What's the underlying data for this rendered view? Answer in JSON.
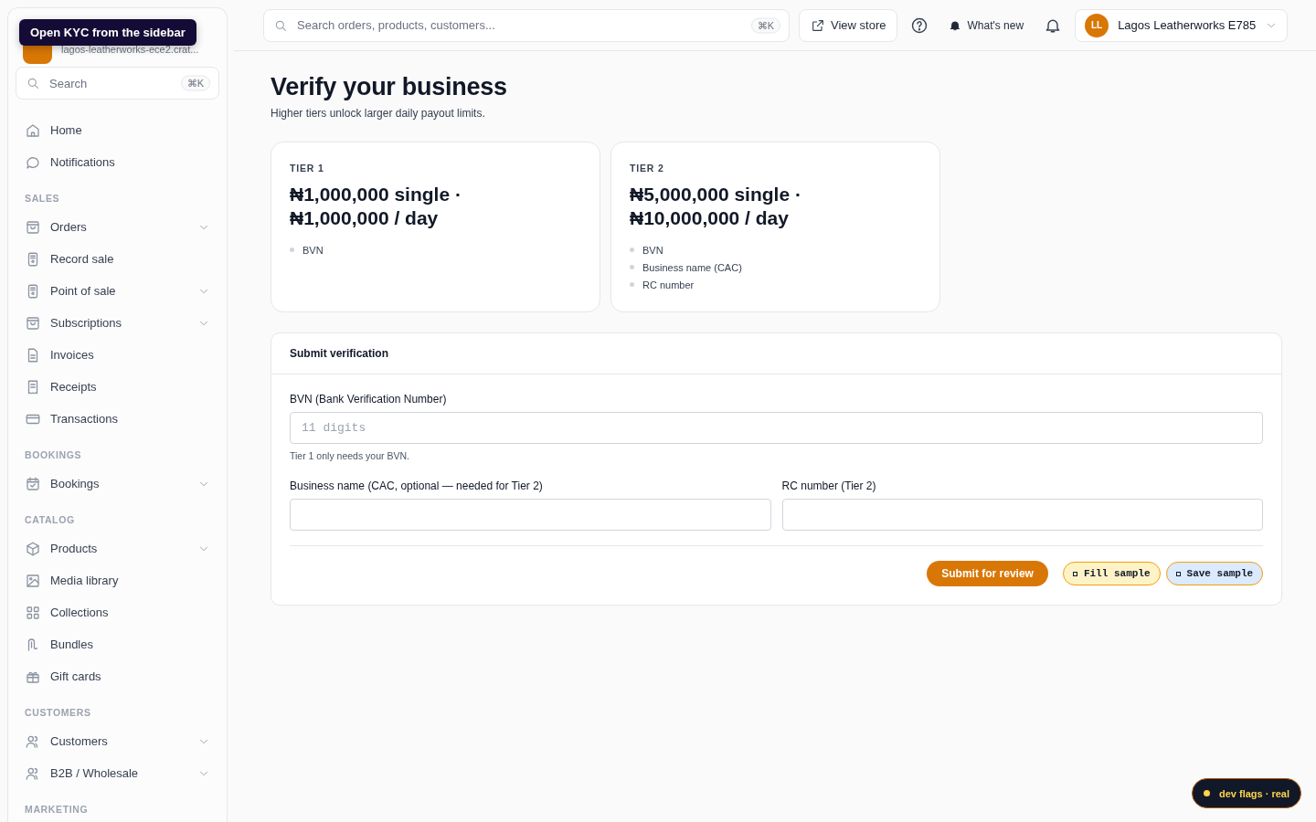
{
  "tooltip": "Open KYC from the sidebar",
  "store": {
    "subdomain": "lagos-leatherworks-ece2.crat..."
  },
  "sidebar_search": {
    "placeholder": "Search",
    "shortcut": "⌘K"
  },
  "nav": [
    {
      "items": [
        {
          "label": "Home",
          "kind": "home",
          "expandable": false
        },
        {
          "label": "Notifications",
          "kind": "chat",
          "expandable": false
        }
      ]
    },
    {
      "heading": "SALES",
      "items": [
        {
          "label": "Orders",
          "kind": "bag",
          "expandable": true
        },
        {
          "label": "Record sale",
          "kind": "pos",
          "expandable": false
        },
        {
          "label": "Point of sale",
          "kind": "pos",
          "expandable": true
        },
        {
          "label": "Subscriptions",
          "kind": "bag",
          "expandable": true
        },
        {
          "label": "Invoices",
          "kind": "doc",
          "expandable": false
        },
        {
          "label": "Receipts",
          "kind": "receipt",
          "expandable": false
        },
        {
          "label": "Transactions",
          "kind": "card",
          "expandable": false
        }
      ]
    },
    {
      "heading": "BOOKINGS",
      "items": [
        {
          "label": "Bookings",
          "kind": "calendar",
          "expandable": true
        }
      ]
    },
    {
      "heading": "CATALOG",
      "items": [
        {
          "label": "Products",
          "kind": "box",
          "expandable": true
        },
        {
          "label": "Media library",
          "kind": "image",
          "expandable": false
        },
        {
          "label": "Collections",
          "kind": "grid",
          "expandable": false
        },
        {
          "label": "Bundles",
          "kind": "bundle",
          "expandable": false
        },
        {
          "label": "Gift cards",
          "kind": "gift",
          "expandable": false
        }
      ]
    },
    {
      "heading": "CUSTOMERS",
      "items": [
        {
          "label": "Customers",
          "kind": "users",
          "expandable": true
        },
        {
          "label": "B2B / Wholesale",
          "kind": "users",
          "expandable": true
        }
      ]
    },
    {
      "heading": "MARKETING"
    }
  ],
  "topbar": {
    "search_placeholder": "Search orders, products, customers...",
    "shortcut": "⌘K",
    "view_store": "View store",
    "whats_new": "What's new",
    "account": {
      "initials": "LL",
      "name": "Lagos Leatherworks E785"
    }
  },
  "page": {
    "title": "Verify your business",
    "subtitle": "Higher tiers unlock larger daily payout limits."
  },
  "tiers": [
    {
      "label": "TIER 1",
      "limits": "₦1,000,000 single · ₦1,000,000 / day",
      "requirements": [
        "BVN"
      ]
    },
    {
      "label": "TIER 2",
      "limits": "₦5,000,000 single · ₦10,000,000 / day",
      "requirements": [
        "BVN",
        "Business name (CAC)",
        "RC number"
      ]
    }
  ],
  "form": {
    "title": "Submit verification",
    "bvn": {
      "label": "BVN (Bank Verification Number)",
      "placeholder": "11 digits",
      "hint": "Tier 1 only needs your BVN."
    },
    "business_name": {
      "label": "Business name (CAC, optional — needed for Tier 2)"
    },
    "rc_number": {
      "label": "RC number (Tier 2)"
    },
    "submit": "Submit for review",
    "dev_buttons": [
      {
        "label": "Fill sample",
        "color": "#fef3c7"
      },
      {
        "label": "Save sample",
        "color": "#dbeafe"
      }
    ]
  },
  "dev_flags": "dev flags · real"
}
